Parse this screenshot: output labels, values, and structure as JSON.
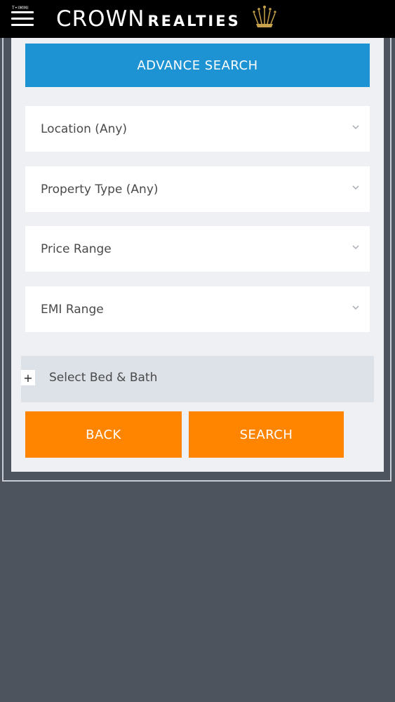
{
  "header": {
    "menu_icon": "hamburger-icon",
    "small_label": "T•IMMI",
    "brand_first": "CROWN",
    "brand_second": "REALTIES",
    "brand_icon": "crown-icon",
    "brand_icon_color": "#c8a24a"
  },
  "search_panel": {
    "title": "ADVANCE SEARCH",
    "fields": [
      {
        "label": "Location (Any)"
      },
      {
        "label": "Property Type (Any)"
      },
      {
        "label": "Price Range"
      },
      {
        "label": "EMI Range"
      }
    ],
    "bed_bath_toggle": "+",
    "bed_bath_label": "Select Bed & Bath",
    "back_label": "BACK",
    "search_label": "SEARCH"
  },
  "colors": {
    "accent_blue": "#1d93d3",
    "accent_orange": "#ff8400",
    "background": "#4e545d"
  }
}
